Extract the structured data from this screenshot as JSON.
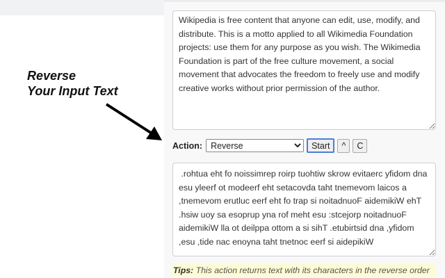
{
  "annotation": {
    "line1": "Reverse",
    "line2": "Your Input Text"
  },
  "input_text": "Wikipedia is free content that anyone can edit, use, modify, and distribute. This is a motto applied to all Wikimedia Foundation projects: use them for any purpose as you wish. The Wikimedia Foundation is part of the free culture movement, a social movement that advocates the freedom to freely use and modify creative works without prior permission of the author.",
  "action": {
    "label": "Action:",
    "selected": "Reverse",
    "start_label": "Start",
    "up_label": "^",
    "clear_label": "C"
  },
  "output_text": " .rohtua eht fo noissimrep roirp tuohtiw skrow evitaerc yfidom dna esu yleerf ot modeerf eht setacovda taht tnemevom laicos a ,tnemevom erutluc eerf eht fo trap si noitadnuoF aidemikiW ehT .hsiw uoy sa esoprup yna rof meht esu :stcejorp noitadnuoF aidemikiW lla ot deilppa ottom a si sihT .etubirtsid dna ,yfidom ,esu ,tide nac enoyna taht tnetnoc eerf si aidepikiW",
  "tips": {
    "label": "Tips:",
    "text": " This action returns text with its characters in the reverse order"
  }
}
